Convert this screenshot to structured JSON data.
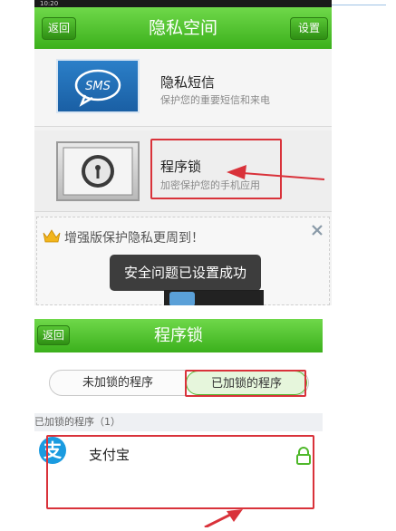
{
  "top_screen": {
    "back_label": "返回",
    "title": "隐私空间",
    "settings_label": "设置",
    "items": [
      {
        "title": "隐私短信",
        "subtitle": "保护您的重要短信和来电",
        "icon_text": "SMS"
      },
      {
        "title": "程序锁",
        "subtitle": "加密保护您的手机应用"
      }
    ],
    "promo_text": "增强版保护隐私更周到！",
    "toast": "安全问题已设置成功"
  },
  "bottom_screen": {
    "back_label": "返回",
    "title": "程序锁",
    "tabs": [
      {
        "label": "未加锁的程序",
        "active": false
      },
      {
        "label": "已加锁的程序",
        "active": true
      }
    ],
    "section_header": "已加锁的程序（1）",
    "apps": [
      {
        "name": "支付宝",
        "icon_glyph": "支",
        "locked": true
      }
    ]
  },
  "colors": {
    "green": "#3bb01c",
    "red_highlight": "#d9323a",
    "lock_green": "#4fb82b",
    "alipay_blue": "#1a9be0"
  }
}
